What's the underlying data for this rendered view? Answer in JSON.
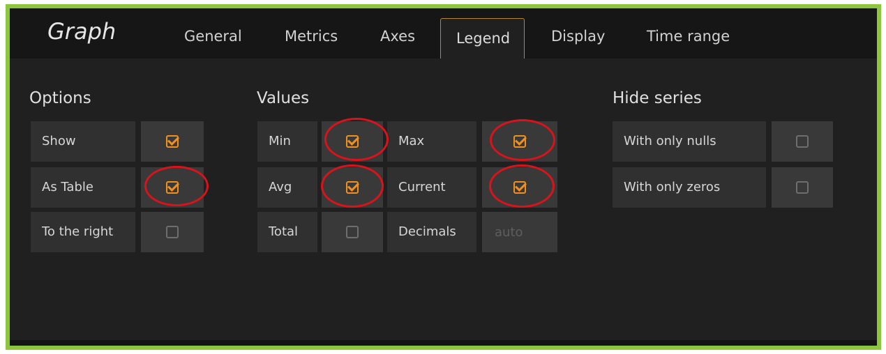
{
  "panel": {
    "title": "Graph"
  },
  "tabs": [
    {
      "label": "General"
    },
    {
      "label": "Metrics"
    },
    {
      "label": "Axes"
    },
    {
      "label": "Legend",
      "active": true
    },
    {
      "label": "Display"
    },
    {
      "label": "Time range"
    }
  ],
  "options": {
    "title": "Options",
    "items": [
      {
        "label": "Show",
        "checked": true,
        "highlighted": false
      },
      {
        "label": "As Table",
        "checked": true,
        "highlighted": true
      },
      {
        "label": "To the right",
        "checked": false,
        "highlighted": false
      }
    ]
  },
  "values": {
    "title": "Values",
    "items": [
      {
        "label": "Min",
        "checked": true,
        "highlighted": true
      },
      {
        "label": "Max",
        "checked": true,
        "highlighted": true
      },
      {
        "label": "Avg",
        "checked": true,
        "highlighted": true
      },
      {
        "label": "Current",
        "checked": true,
        "highlighted": true
      },
      {
        "label": "Total",
        "checked": false,
        "highlighted": false
      }
    ],
    "decimals": {
      "label": "Decimals",
      "value": "",
      "placeholder": "auto"
    }
  },
  "hide_series": {
    "title": "Hide series",
    "items": [
      {
        "label": "With only nulls",
        "checked": false
      },
      {
        "label": "With only zeros",
        "checked": false
      }
    ]
  },
  "colors": {
    "frame_border": "#8cc63f",
    "checkbox_on": "#f0901e",
    "highlight_ring": "#d7141c",
    "active_tab_border": "#b8862e"
  }
}
